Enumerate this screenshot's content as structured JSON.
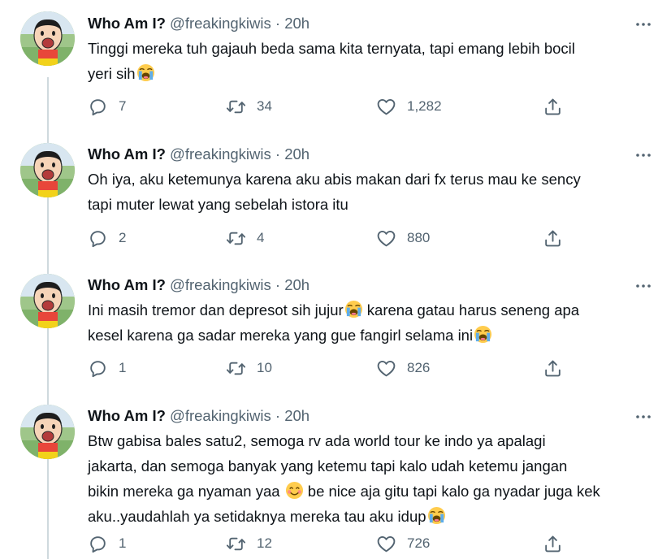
{
  "tweets": [
    {
      "name": "Who Am I?",
      "handle": "@freakingkiwis",
      "sep": "·",
      "time": "20h",
      "line1": "Tinggi mereka tuh gajauh beda sama kita ternyata, tapi emang lebih bocil",
      "line2": "yeri sih",
      "replies": "7",
      "retweets": "34",
      "likes": "1,282"
    },
    {
      "name": "Who Am I?",
      "handle": "@freakingkiwis",
      "sep": "·",
      "time": "20h",
      "line1": "Oh iya, aku ketemunya karena aku abis makan dari fx terus mau ke sency",
      "line2": "tapi muter lewat yang sebelah istora itu",
      "replies": "2",
      "retweets": "4",
      "likes": "880"
    },
    {
      "name": "Who Am I?",
      "handle": "@freakingkiwis",
      "sep": "·",
      "time": "20h",
      "line1a": "Ini masih tremor dan depresot sih jujur",
      "line1b": " karena gatau harus seneng apa",
      "line2": "kesel karena ga sadar mereka yang gue fangirl selama ini",
      "replies": "1",
      "retweets": "10",
      "likes": "826"
    },
    {
      "name": "Who Am I?",
      "handle": "@freakingkiwis",
      "sep": "·",
      "time": "20h",
      "line1": "Btw gabisa bales satu2, semoga rv ada world tour ke indo ya apalagi",
      "line2": "jakarta, dan semoga banyak yang ketemu tapi kalo udah ketemu jangan",
      "line3a": "bikin mereka ga nyaman yaa ",
      "line3b": " be nice aja gitu tapi kalo ga nyadar juga kek",
      "line4": "aku..yaudahlah ya setidaknya mereka tau aku idup",
      "replies": "1",
      "retweets": "12",
      "likes": "726"
    }
  ],
  "icons": {
    "reply": "reply-icon",
    "retweet": "retweet-icon",
    "like": "heart-icon",
    "share": "share-icon",
    "more": "more-icon",
    "crying": "loudly-crying-face-emoji",
    "smiling": "smiling-face-emoji"
  },
  "colors": {
    "text": "#0f1419",
    "muted": "#536471",
    "thread_line": "#cfd9de"
  }
}
